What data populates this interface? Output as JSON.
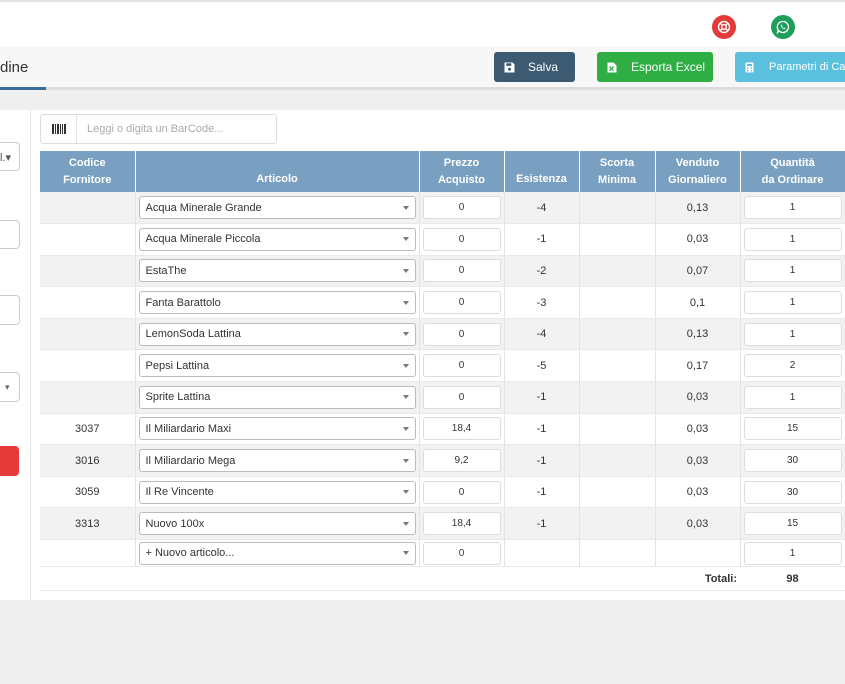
{
  "page": {
    "title": "dine"
  },
  "toolbar": {
    "save_label": "Salva",
    "excel_label": "Esporta Excel",
    "params_label": "Parametri di Calc"
  },
  "left_panel": {
    "field1_value": "l.▾"
  },
  "barcode": {
    "placeholder": "Leggi o digita un BarCode..."
  },
  "table": {
    "headers": {
      "codice_1": "Codice",
      "codice_2": "Fornitore",
      "articolo": "Articolo",
      "prezzo_1": "Prezzo",
      "prezzo_2": "Acquisto",
      "esistenza": "Esistenza",
      "scorta_1": "Scorta",
      "scorta_2": "Minima",
      "venduto_1": "Venduto",
      "venduto_2": "Giornaliero",
      "quantita_1": "Quantità",
      "quantita_2": "da Ordinare"
    },
    "rows": [
      {
        "codice": "",
        "articolo": "Acqua Minerale Grande",
        "prezzo": "0",
        "esistenza": "-4",
        "scorta": "",
        "venduto": "0,13",
        "quantita": "1"
      },
      {
        "codice": "",
        "articolo": "Acqua Minerale Piccola",
        "prezzo": "0",
        "esistenza": "-1",
        "scorta": "",
        "venduto": "0,03",
        "quantita": "1"
      },
      {
        "codice": "",
        "articolo": "EstaThe",
        "prezzo": "0",
        "esistenza": "-2",
        "scorta": "",
        "venduto": "0,07",
        "quantita": "1"
      },
      {
        "codice": "",
        "articolo": "Fanta Barattolo",
        "prezzo": "0",
        "esistenza": "-3",
        "scorta": "",
        "venduto": "0,1",
        "quantita": "1"
      },
      {
        "codice": "",
        "articolo": "LemonSoda Lattina",
        "prezzo": "0",
        "esistenza": "-4",
        "scorta": "",
        "venduto": "0,13",
        "quantita": "1"
      },
      {
        "codice": "",
        "articolo": "Pepsi Lattina",
        "prezzo": "0",
        "esistenza": "-5",
        "scorta": "",
        "venduto": "0,17",
        "quantita": "2"
      },
      {
        "codice": "",
        "articolo": "Sprite Lattina",
        "prezzo": "0",
        "esistenza": "-1",
        "scorta": "",
        "venduto": "0,03",
        "quantita": "1"
      },
      {
        "codice": "3037",
        "articolo": "Il Miliardario Maxi",
        "prezzo": "18,4",
        "esistenza": "-1",
        "scorta": "",
        "venduto": "0,03",
        "quantita": "15"
      },
      {
        "codice": "3016",
        "articolo": "Il Miliardario Mega",
        "prezzo": "9,2",
        "esistenza": "-1",
        "scorta": "",
        "venduto": "0,03",
        "quantita": "30"
      },
      {
        "codice": "3059",
        "articolo": "Il Re Vincente",
        "prezzo": "0",
        "esistenza": "-1",
        "scorta": "",
        "venduto": "0,03",
        "quantita": "30"
      },
      {
        "codice": "3313",
        "articolo": "Nuovo 100x",
        "prezzo": "18,4",
        "esistenza": "-1",
        "scorta": "",
        "venduto": "0,03",
        "quantita": "15"
      }
    ],
    "new_row": {
      "articolo": "+ Nuovo articolo...",
      "prezzo": "0",
      "quantita": "1"
    },
    "totals": {
      "label": "Totali:",
      "value": "98"
    }
  },
  "colors": {
    "header_bg": "#7aa0c1",
    "save_bg": "#3d5a73",
    "excel_bg": "#2fae44",
    "params_bg": "#5bc0de",
    "help_icon": "#e33a3a",
    "whatsapp_icon": "#1e9e5a"
  },
  "icons": {
    "help": "lifebuoy-icon",
    "whatsapp": "whatsapp-icon",
    "save": "floppy-disk-icon",
    "excel": "excel-file-icon",
    "params": "calculator-icon",
    "barcode": "barcode-icon",
    "select": "caret-down-icon"
  }
}
